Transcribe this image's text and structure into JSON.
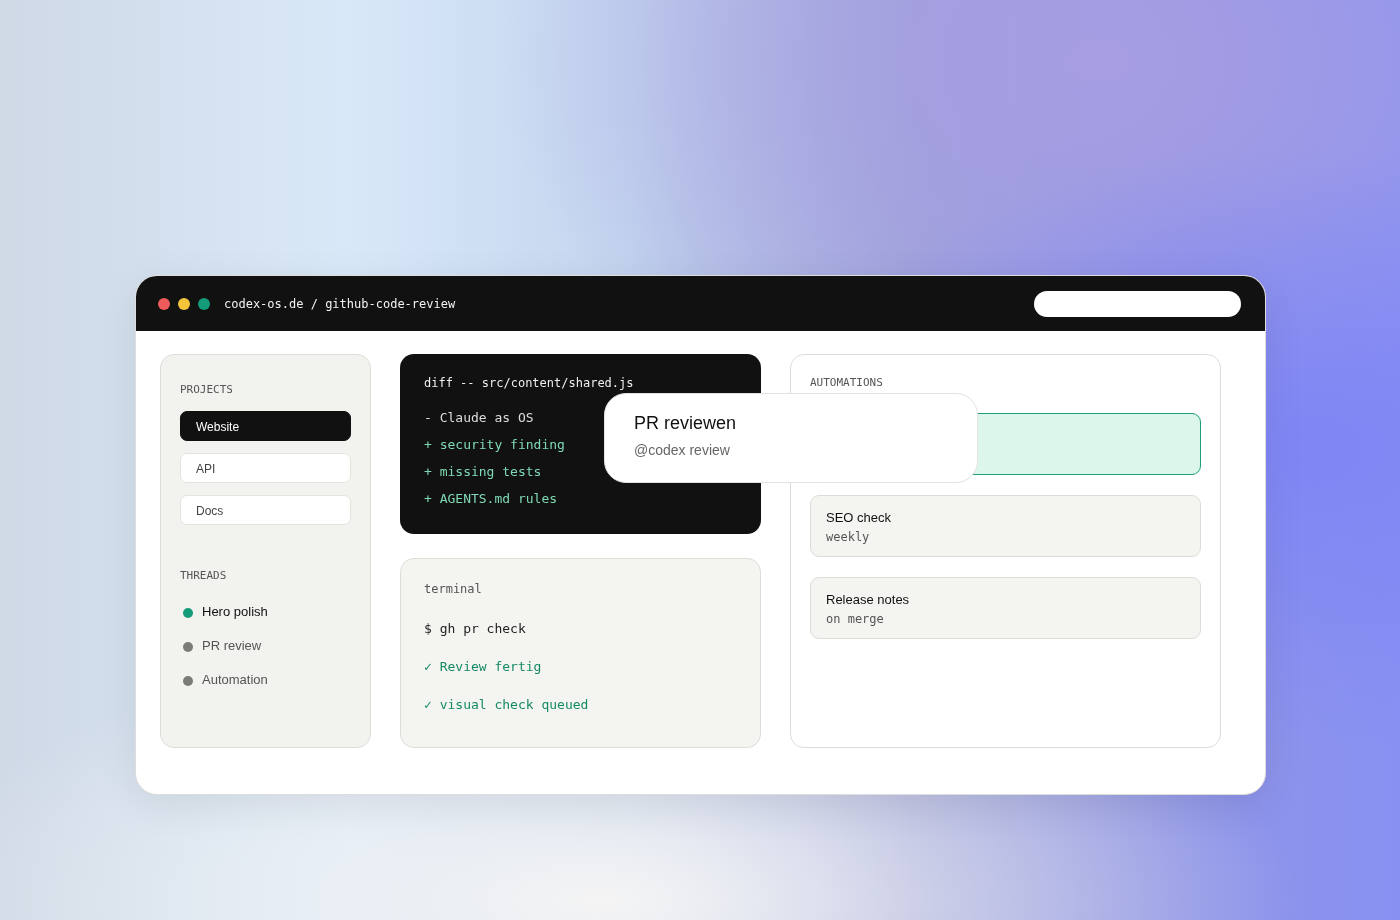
{
  "window": {
    "path": "codex-os.de / github-code-review"
  },
  "sidebar": {
    "projects_heading": "PROJECTS",
    "projects": [
      {
        "label": "Website",
        "selected": true
      },
      {
        "label": "API",
        "selected": false
      },
      {
        "label": "Docs",
        "selected": false
      }
    ],
    "threads_heading": "THREADS",
    "threads": [
      {
        "label": "Hero polish",
        "color": "#149c7a",
        "selected": true
      },
      {
        "label": "PR review",
        "color": "#7b7b78",
        "selected": false
      },
      {
        "label": "Automation",
        "color": "#7b7b78",
        "selected": false
      }
    ]
  },
  "diff": {
    "header": "diff -- src/content/shared.js",
    "lines": [
      {
        "kind": "removed",
        "text": "- Claude as OS"
      },
      {
        "kind": "added",
        "text": "+ security finding"
      },
      {
        "kind": "added",
        "text": "+ missing tests"
      },
      {
        "kind": "added",
        "text": "+ AGENTS.md rules"
      }
    ]
  },
  "terminal": {
    "title": "terminal",
    "lines": [
      {
        "kind": "command",
        "text": "$ gh pr check"
      },
      {
        "kind": "ok",
        "text": "✓ Review fertig"
      },
      {
        "kind": "ok",
        "text": "✓ visual check queued"
      }
    ]
  },
  "automations": {
    "heading": "AUTOMATIONS",
    "items": [
      {
        "selected": true
      },
      {
        "name": "SEO check",
        "schedule": "weekly",
        "selected": false
      },
      {
        "name": "Release notes",
        "schedule": "on merge",
        "selected": false
      }
    ]
  },
  "popup": {
    "title": "PR reviewen",
    "subtitle": "@codex review"
  }
}
